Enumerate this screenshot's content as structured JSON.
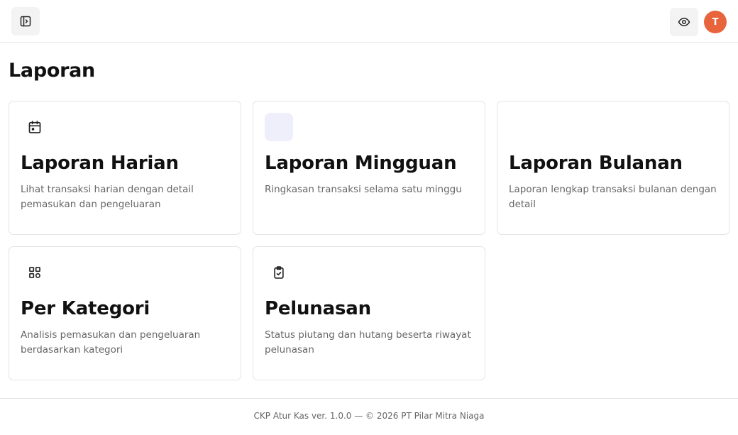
{
  "header": {
    "avatar_initial": "T"
  },
  "page": {
    "title": "Laporan"
  },
  "cards": [
    {
      "title": "Laporan Harian",
      "description": "Lihat transaksi harian dengan detail pemasukan dan pengeluaran",
      "icon": "calendar-icon"
    },
    {
      "title": "Laporan Mingguan",
      "description": "Ringkasan transaksi selama satu minggu",
      "icon": "placeholder-icon"
    },
    {
      "title": "Laporan Bulanan",
      "description": "Laporan lengkap transaksi bulanan dengan detail",
      "icon": "none"
    },
    {
      "title": "Per Kategori",
      "description": "Analisis pemasukan dan pengeluaran berdasarkan kategori",
      "icon": "category-grid-icon"
    },
    {
      "title": "Pelunasan",
      "description": "Status piutang dan hutang beserta riwayat pelunasan",
      "icon": "clipboard-check-icon"
    }
  ],
  "footer": {
    "text": "CKP Atur Kas ver. 1.0.0 — © 2026 PT Pilar Mitra Niaga"
  },
  "colors": {
    "avatar_bg": "#e8643c",
    "icon_tint": "#efeefb",
    "border": "#e4e4e4",
    "muted_text": "#666666"
  }
}
